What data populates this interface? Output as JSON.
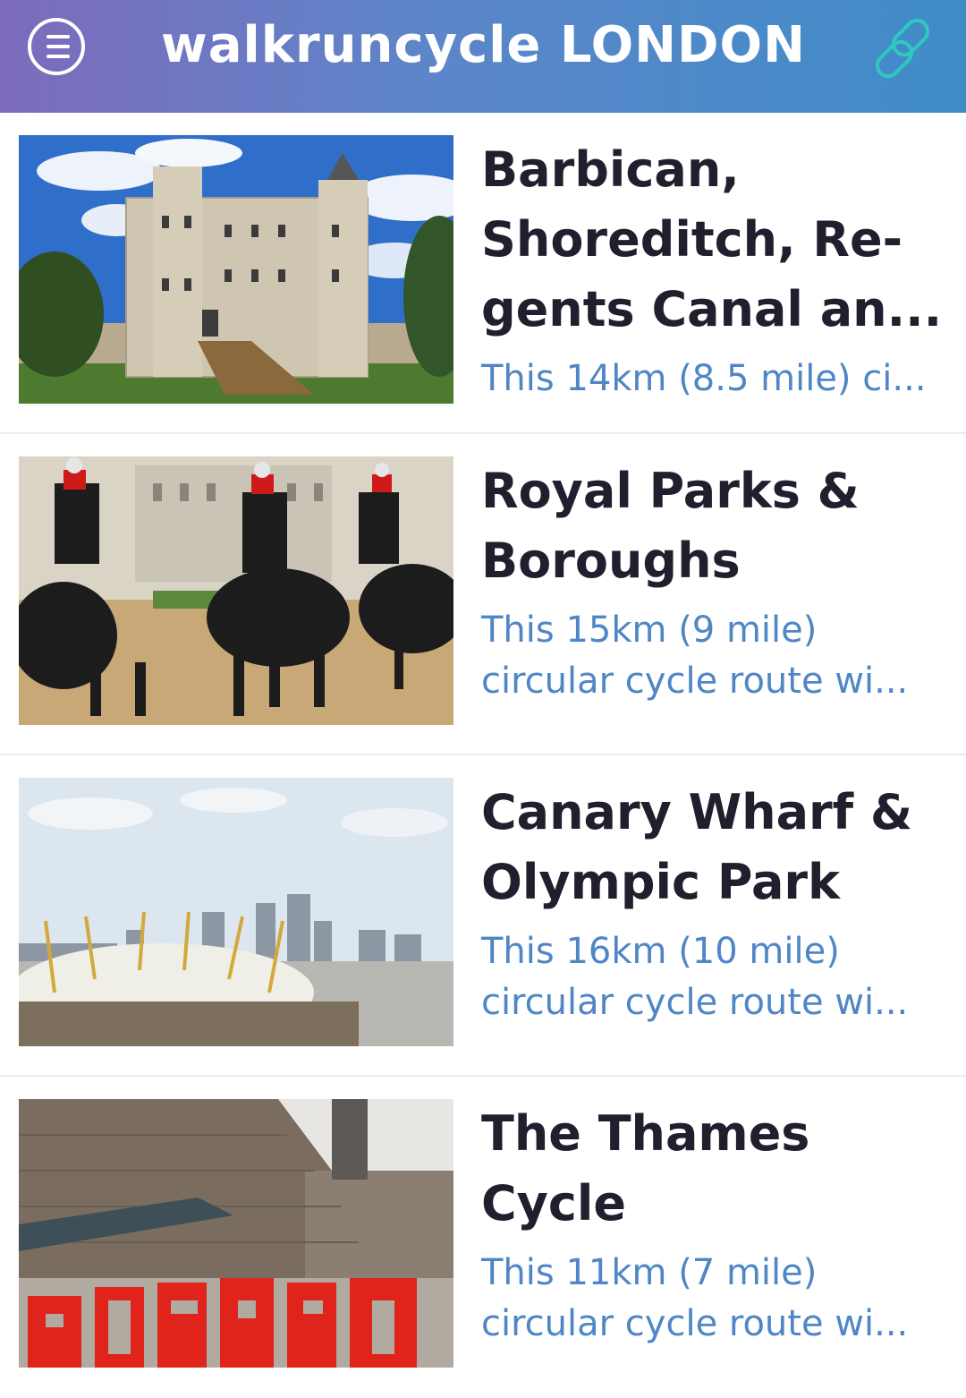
{
  "header": {
    "title": "walkruncycle LONDON",
    "menu_icon": "hamburger-menu-icon",
    "link_icon": "link-icon",
    "colors": {
      "gradient_start": "#7d6bbc",
      "gradient_end": "#3f8cc8",
      "link_icon": "#2fc8c0"
    }
  },
  "routes": [
    {
      "title_lines": [
        "Barbican,",
        "Shoreditch, Re-",
        "gents Canal an..."
      ],
      "desc_lines": [
        "This 14km (8.5 mile) ci..."
      ],
      "image": "tower-of-london-photo"
    },
    {
      "title_lines": [
        "Royal Parks &",
        "Boroughs"
      ],
      "desc_lines": [
        "This 15km (9 mile)",
        "circular cycle route wi..."
      ],
      "image": "household-cavalry-photo"
    },
    {
      "title_lines": [
        "Canary Wharf &",
        "Olympic Park"
      ],
      "desc_lines": [
        "This 16km (10 mile)",
        "circular cycle route wi..."
      ],
      "image": "o2-arena-canary-wharf-photo"
    },
    {
      "title_lines": [
        "The Thames",
        "Cycle"
      ],
      "desc_lines": [
        "This 11km (7 mile)",
        "circular cycle route wi..."
      ],
      "image": "tate-modern-photo"
    }
  ],
  "colors": {
    "title_text": "#1f1f2e",
    "desc_text": "#4f86c6",
    "divider": "#ebebeb"
  }
}
